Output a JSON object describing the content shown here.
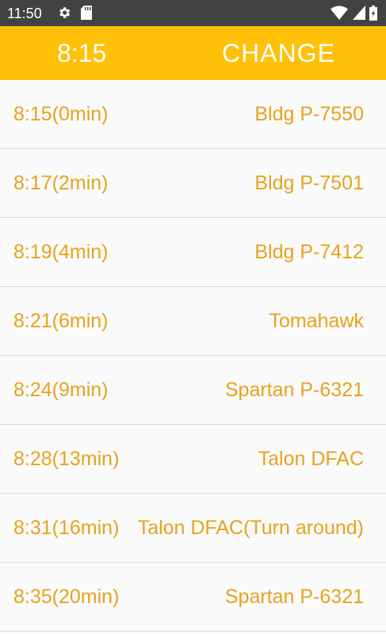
{
  "status_bar": {
    "time": "11:50",
    "icons": [
      "gear-icon",
      "sd-card-icon",
      "wifi-icon",
      "signal-icon",
      "battery-icon"
    ]
  },
  "app_bar": {
    "time": "8:15",
    "change_label": "CHANGE",
    "color": "#ffc107"
  },
  "colors": {
    "accent_text": "#e8a21c",
    "status_bar_bg": "#424242",
    "list_bg": "#fafafa"
  },
  "schedule": [
    {
      "time": "8:15(0min)",
      "stop": "Bldg P-7550"
    },
    {
      "time": "8:17(2min)",
      "stop": "Bldg P-7501"
    },
    {
      "time": "8:19(4min)",
      "stop": "Bldg P-7412"
    },
    {
      "time": "8:21(6min)",
      "stop": "Tomahawk"
    },
    {
      "time": "8:24(9min)",
      "stop": "Spartan P-6321"
    },
    {
      "time": "8:28(13min)",
      "stop": "Talon DFAC"
    },
    {
      "time": "8:31(16min)",
      "stop": "Talon DFAC(Turn around)"
    },
    {
      "time": "8:35(20min)",
      "stop": "Spartan P-6321"
    }
  ]
}
